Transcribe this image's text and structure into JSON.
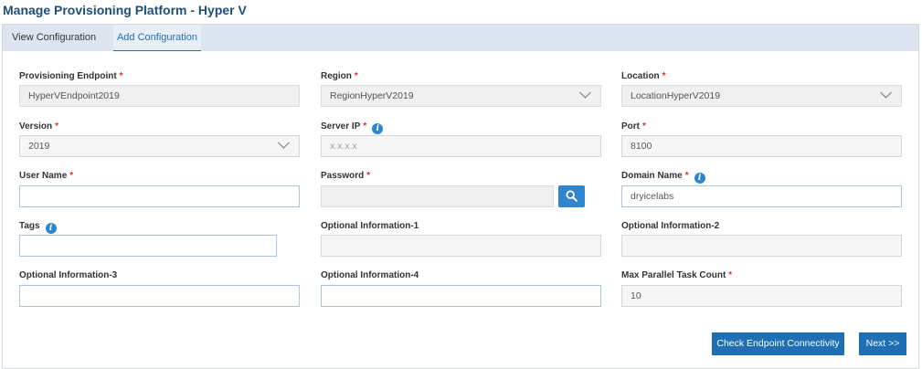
{
  "page": {
    "title": "Manage Provisioning Platform - Hyper V"
  },
  "tabs": {
    "view": "View Configuration",
    "add": "Add Configuration"
  },
  "required_mark": "*",
  "fields": {
    "endpoint": {
      "label": "Provisioning Endpoint",
      "value": "HyperVEndpoint2019"
    },
    "region": {
      "label": "Region",
      "value": "RegionHyperV2019"
    },
    "location": {
      "label": "Location",
      "value": "LocationHyperV2019"
    },
    "version": {
      "label": "Version",
      "value": "2019"
    },
    "server_ip": {
      "label": "Server IP",
      "placeholder": "x.x.x.x"
    },
    "port": {
      "label": "Port",
      "value": "8100"
    },
    "user_name": {
      "label": "User Name",
      "value": ""
    },
    "password": {
      "label": "Password",
      "value": ""
    },
    "domain_name": {
      "label": "Domain Name",
      "value": "dryicelabs"
    },
    "tags": {
      "label": "Tags",
      "value": ""
    },
    "opt1": {
      "label": "Optional Information-1",
      "value": ""
    },
    "opt2": {
      "label": "Optional Information-2",
      "value": ""
    },
    "opt3": {
      "label": "Optional Information-3",
      "value": ""
    },
    "opt4": {
      "label": "Optional Information-4",
      "value": ""
    },
    "max_parallel": {
      "label": "Max Parallel Task Count",
      "value": "10"
    }
  },
  "buttons": {
    "check": "Check Endpoint Connectivity",
    "next": "Next >>"
  },
  "icons": {
    "info": "info-icon",
    "search": "search-icon",
    "dropdown": "chevron-down-icon"
  },
  "colors": {
    "accent": "#1f6fb5",
    "title": "#1f4e79",
    "required": "#d9302c"
  }
}
